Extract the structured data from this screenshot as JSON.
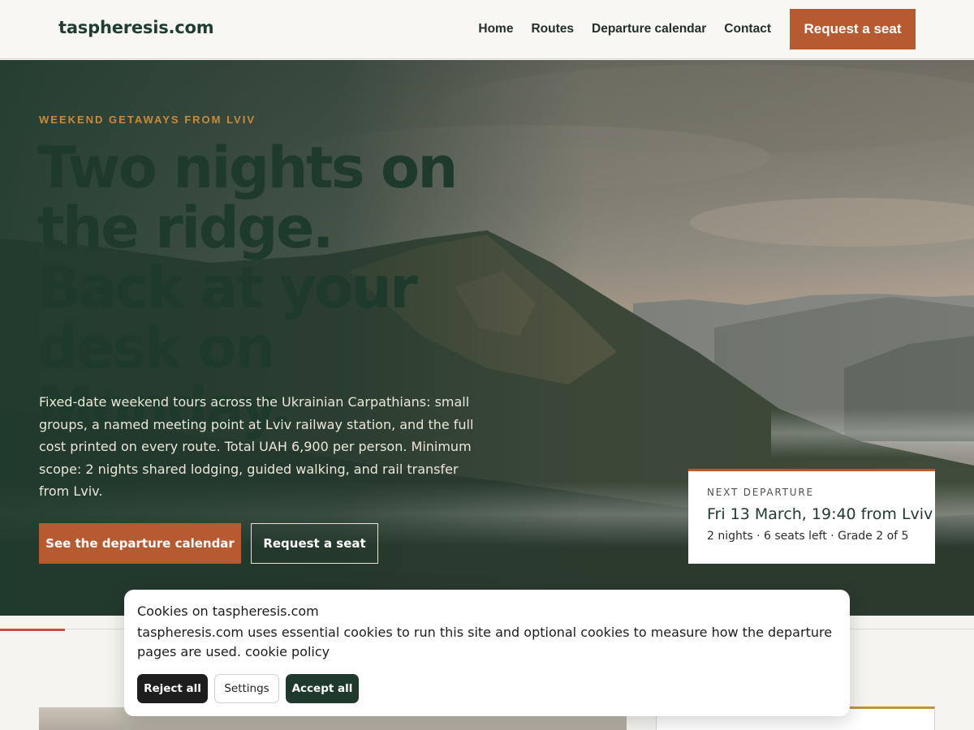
{
  "site": {
    "brand": "taspheresis.com"
  },
  "nav": {
    "items": [
      "Home",
      "Routes",
      "Departure calendar",
      "Contact"
    ],
    "cta_label": "Request a seat"
  },
  "hero": {
    "eyebrow": "WEEKEND GETAWAYS FROM LVIV",
    "headline": "Two nights on the ridge. Back at your desk on Monday.",
    "body": "Fixed-date weekend tours across the Ukrainian Carpathians: small groups, a named meeting point at Lviv railway station, and the full cost printed on every route. Total UAH 6,900 per person. Minimum scope: 2 nights shared lodging, guided walking, and rail transfer from Lviv.",
    "primary_button": "See the departure calendar",
    "secondary_button": "Request a seat",
    "next_departure": {
      "label": "NEXT DEPARTURE",
      "date": "Fri 13 March, 19:40 from Lviv",
      "meta": "2 nights · 6 seats left · Grade 2 of 5"
    }
  },
  "cookie_banner": {
    "title": "Cookies on taspheresis.com",
    "text": "taspheresis.com uses essential cookies to run this site and optional cookies to measure how the departure pages are used.",
    "policy_link": "cookie policy",
    "reject_label": "Reject all",
    "settings_label": "Settings",
    "accept_label": "Accept all"
  },
  "colors": {
    "accent": "#b65a31",
    "brand_green": "#1f3d30",
    "eyebrow": "#c98a3d"
  }
}
